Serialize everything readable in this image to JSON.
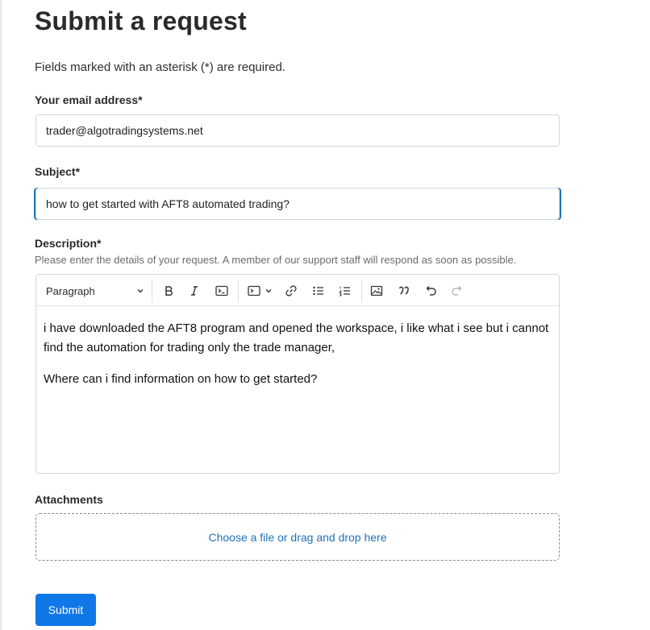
{
  "page": {
    "title": "Submit a request",
    "required_note": "Fields marked with an asterisk (*) are required."
  },
  "email": {
    "label": "Your email address*",
    "value": "trader@algotradingsystems.net"
  },
  "subject": {
    "label": "Subject*",
    "value": "how to get started with AFT8 automated trading?"
  },
  "description": {
    "label": "Description*",
    "hint": "Please enter the details of your request. A member of our support staff will respond as soon as possible.",
    "toolbar": {
      "block_format": "Paragraph",
      "icons": [
        "bold-icon",
        "italic-icon",
        "code-icon",
        "code-block-icon",
        "link-icon",
        "bullet-list-icon",
        "numbered-list-icon",
        "image-icon",
        "quote-icon",
        "undo-icon",
        "redo-icon"
      ]
    },
    "paragraphs": [
      "i have downloaded the AFT8 program and opened the workspace, i like what i see but i cannot find the automation for trading only the trade manager,",
      "Where can i find information on how to get started?"
    ]
  },
  "attachments": {
    "label": "Attachments",
    "dropzone_text": "Choose a file or drag and drop here"
  },
  "actions": {
    "submit_label": "Submit"
  },
  "colors": {
    "accent": "#0f77e8",
    "link": "#1f73b7"
  }
}
